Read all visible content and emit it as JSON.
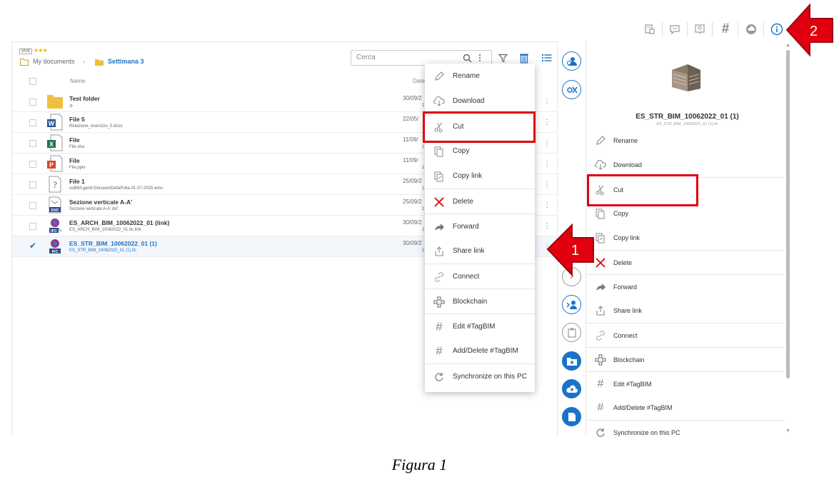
{
  "top_toolbar": {
    "hash_glyph": "#",
    "icons": [
      "document-scan-icon",
      "chat-edit-icon",
      "presentation-icon",
      "hash-icon",
      "cloud-upload-icon",
      "info-icon"
    ]
  },
  "header": {
    "badge": "VUE",
    "stars": "★★★",
    "breadcrumb_root": "My documents",
    "breadcrumb_separator": "›",
    "breadcrumb_current": "Settimana 3",
    "search_placeholder": "Cerca"
  },
  "columns": {
    "name": "Name",
    "date": "Date"
  },
  "files": [
    {
      "name": "Test folder",
      "sub": "",
      "date": "30/09/2",
      "date2": "1",
      "type": "folder"
    },
    {
      "name": "File 5",
      "sub": "Relazione_esercizio_5.docx",
      "date": "22/05/",
      "date2": "1",
      "type": "word"
    },
    {
      "name": "File",
      "sub": "File.xlsx",
      "date": "11/09/",
      "date2": "1",
      "type": "excel"
    },
    {
      "name": "File",
      "sub": "File.pptx",
      "date": "11/09/",
      "date2": "1",
      "type": "powerpoint"
    },
    {
      "name": "File 1",
      "sub": "usBIM.gantt-GiovanniDellaPolla-01-07-2025.wmv",
      "date": "25/09/2",
      "date2": "1",
      "type": "unknown"
    },
    {
      "name": "Sezione verticale A-A'",
      "sub": "Sezione verticale A-A'.dxf",
      "date": "25/09/2",
      "date2": "1",
      "type": "dxf"
    },
    {
      "name": "ES_ARCH_BIM_10062022_01 (link)",
      "sub": "ES_ARCH_BIM_10062022_01.ifc.link",
      "date": "30/09/2",
      "date2": "1",
      "type": "ifc"
    },
    {
      "name": "ES_STR_BIM_10062022_01 (1)",
      "sub": "ES_STR_BIM_10062022_01 (1).ifc",
      "date": "30/09/2",
      "date2": "1",
      "type": "ifc"
    }
  ],
  "file_badges": {
    "word": "W",
    "excel": "X",
    "powerpoint": "P",
    "unknown": "?",
    "dxf": "DXF",
    "ifc": "IFC"
  },
  "context_menu": [
    {
      "label": "Rename",
      "icon": "pencil-icon"
    },
    {
      "label": "Download",
      "icon": "cloud-download-icon"
    },
    {
      "label": "Cut",
      "icon": "scissors-icon"
    },
    {
      "label": "Copy",
      "icon": "copy-icon"
    },
    {
      "label": "Copy link",
      "icon": "copy-link-icon"
    },
    {
      "label": "Delete",
      "icon": "delete-x-icon"
    },
    {
      "label": "Forward",
      "icon": "forward-arrow-icon"
    },
    {
      "label": "Share link",
      "icon": "share-icon"
    },
    {
      "label": "Connect",
      "icon": "link-icon"
    },
    {
      "label": "Blockchain",
      "icon": "blockchain-icon"
    },
    {
      "label": "Edit #TagBIM",
      "icon": "hash-edit-icon"
    },
    {
      "label": "Add/Delete #TagBIM",
      "icon": "hash-add-icon"
    },
    {
      "label": "Synchronize on this PC",
      "icon": "sync-icon"
    }
  ],
  "detail": {
    "title": "ES_STR_BIM_10062022_01 (1)",
    "subtitle": "ES_STR_BIM_10062022_01 (1).ifc"
  },
  "caption": "Figura 1",
  "callouts": {
    "one": "1",
    "two": "2"
  },
  "colors": {
    "accent": "#1a73c9",
    "highlight": "#e0000f",
    "delete": "#e0000f"
  }
}
